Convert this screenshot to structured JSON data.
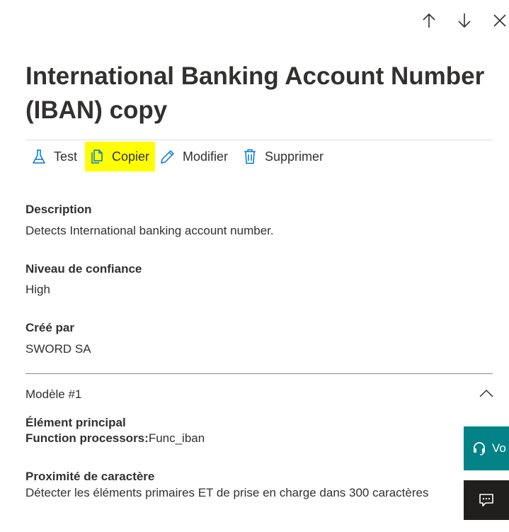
{
  "panel": {
    "title": "International Banking Account Number (IBAN) copy"
  },
  "toolbar": {
    "test_label": "Test",
    "copy_label": "Copier",
    "edit_label": "Modifier",
    "delete_label": "Supprimer",
    "copy_highlight_color": "#ffff00"
  },
  "details": {
    "description_label": "Description",
    "description_value": "Detects International banking account number.",
    "confidence_label": "Niveau de confiance",
    "confidence_value": "High",
    "created_by_label": "Créé par",
    "created_by_value": "SWORD SA"
  },
  "model": {
    "header": "Modèle #1",
    "primary_element_label": "Élément principal",
    "function_processors_label": "Function processors:",
    "function_processors_value": "Func_iban",
    "proximity_label": "Proximité de caractère",
    "proximity_value": "Détecter les éléments primaires ET de prise en charge dans 300 caractères"
  },
  "floating": {
    "help_label": "Vo",
    "help_icon": "headset-icon",
    "chat_icon": "chat-icon",
    "help_color": "#038387",
    "chat_color": "#201f1e"
  },
  "icons": {
    "up": "arrow-up-icon",
    "down": "arrow-down-icon",
    "close": "close-icon",
    "test": "flask-icon",
    "copy": "copy-icon",
    "edit": "pencil-icon",
    "delete": "trash-icon",
    "collapse": "chevron-up-icon"
  }
}
